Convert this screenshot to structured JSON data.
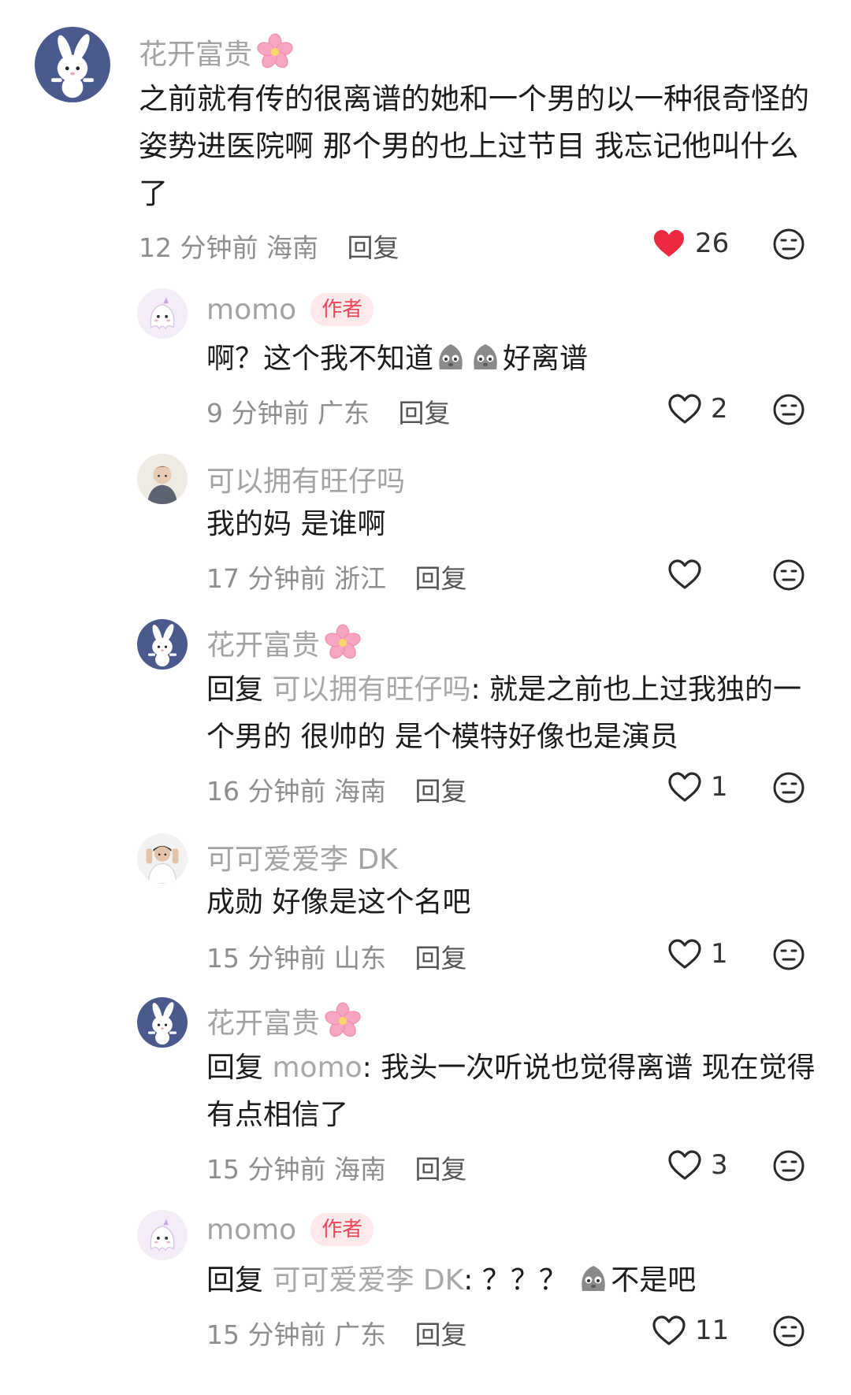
{
  "comments": [
    {
      "name": "花开富贵",
      "body_parts": [
        "之前就有传的很离谱的她和一个男的以一种很奇怪的姿势进医院啊 那个男的也上过节目 我忘记他叫什么了"
      ],
      "time": "12 分钟前 海南",
      "reply": "回复",
      "likes": "26"
    },
    {
      "name": "momo",
      "badge": "作者",
      "body_a": "啊？这个我不知道",
      "body_b": "好离谱",
      "time": "9 分钟前 广东",
      "reply": "回复",
      "likes": "2"
    },
    {
      "name": "可以拥有旺仔吗",
      "body": "我的妈 是谁啊",
      "time": "17 分钟前 浙江",
      "reply": "回复",
      "likes": ""
    },
    {
      "name": "花开富贵",
      "reply_prefix": "回复",
      "mention": "可以拥有旺仔吗",
      "body": ": 就是之前也上过我独的一个男的 很帅的 是个模特好像也是演员",
      "time": "16 分钟前 海南",
      "reply": "回复",
      "likes": "1"
    },
    {
      "name": "可可爱爱李 DK",
      "body": "成勋 好像是这个名吧",
      "time": "15 分钟前 山东",
      "reply": "回复",
      "likes": "1"
    },
    {
      "name": "花开富贵",
      "reply_prefix": "回复",
      "mention": "momo",
      "body": ": 我头一次听说也觉得离谱 现在觉得有点相信了",
      "time": "15 分钟前 海南",
      "reply": "回复",
      "likes": "3"
    },
    {
      "name": "momo",
      "badge": "作者",
      "reply_prefix": "回复",
      "mention": "可可爱爱李 DK",
      "body_a": ": ？？？",
      "body_b": "不是吧",
      "time": "15 分钟前 广东",
      "reply": "回复",
      "likes": "11"
    }
  ],
  "colors": {
    "like_active": "#ee2a43",
    "name": "#a3a3a3",
    "badge_bg": "#fde8ea",
    "badge_text": "#f0455a"
  }
}
